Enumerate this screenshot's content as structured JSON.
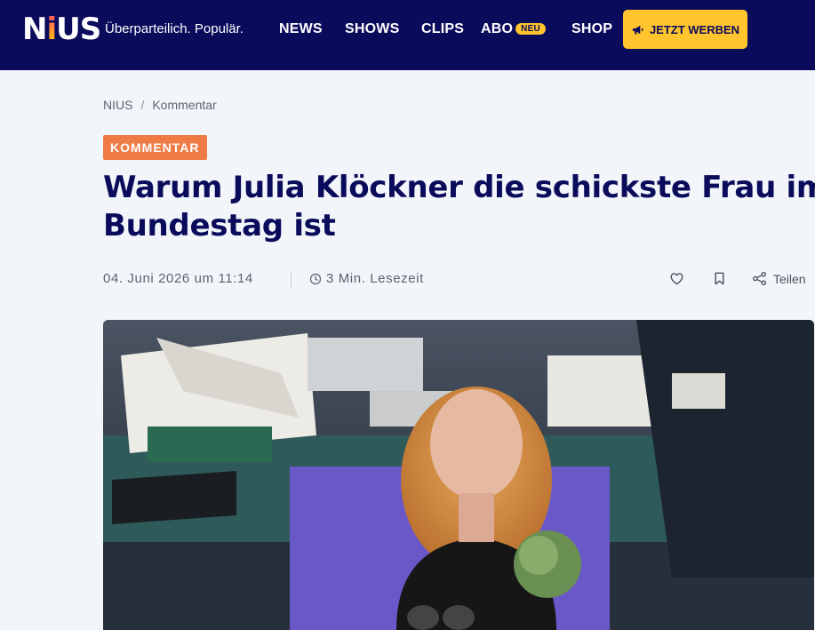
{
  "header": {
    "logo": "NIUS",
    "tagline": "Überparteilich. Populär.",
    "nav": {
      "news": "NEWS",
      "shows": "SHOWS",
      "clips": "CLIPS",
      "abo": "ABO",
      "abo_badge": "NEU",
      "shop": "SHOP"
    },
    "cta_label": "JETZT WERBEN"
  },
  "breadcrumb": {
    "home": "NIUS",
    "separator": "/",
    "current": "Kommentar"
  },
  "article": {
    "kicker": "KOMMENTAR",
    "headline_line1": "Warum Julia Klöckner die schickste Frau im",
    "headline_line2": "Bundestag ist",
    "date": "04. Juni 2026 um 11:14",
    "read_time": "3 Min. Lesezeit",
    "share_label": "Teilen"
  },
  "colors": {
    "header_bg": "#0b0b5c",
    "accent_yellow": "#ffc42e",
    "kicker_orange": "#ef7b45",
    "headline": "#0b0b5c",
    "page_bg": "#f2f5f9"
  },
  "icons": {
    "cta": "megaphone-icon",
    "read_time": "clock-icon",
    "like": "heart-icon",
    "save": "bookmark-icon",
    "share": "share-icon"
  }
}
